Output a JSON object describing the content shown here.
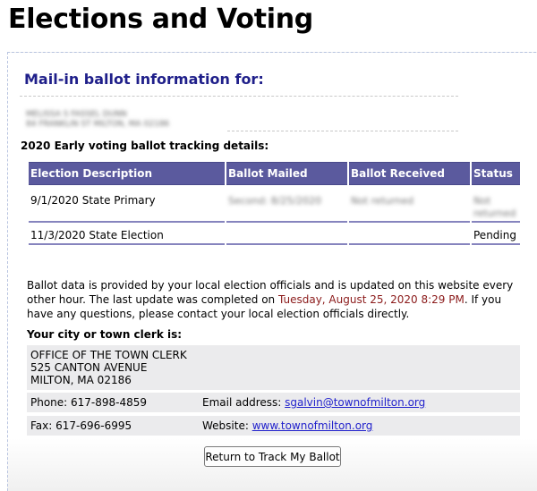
{
  "page": {
    "title": "Elections and Voting"
  },
  "panel": {
    "heading": "Mail-in ballot information for:",
    "voter": {
      "name_line": "MELISSA S FASSEL DUNN",
      "address_line": "84 FRANKLIN ST MILTON, MA 02186",
      "redacted": true
    }
  },
  "tracking": {
    "section_title": "2020  Early voting ballot tracking details:",
    "columns": [
      "Election Description",
      "Ballot Mailed",
      "Ballot Received",
      "Status"
    ],
    "rows": [
      {
        "election": "9/1/2020 State Primary",
        "mailed": "Second: 8/25/2020",
        "received": "Not returned",
        "status": "Not returned",
        "redacted": true
      },
      {
        "election": "11/3/2020 State Election",
        "mailed": "",
        "received": "",
        "status": "Pending"
      }
    ]
  },
  "info": {
    "text_before": "Ballot data is provided by your local election officials and is updated on this website every other hour. The last update was completed on ",
    "last_update": "Tuesday, August 25, 2020 8:29 PM",
    "text_after": ". If you have any questions, please contact your local election officials directly."
  },
  "clerk": {
    "title": "Your city or town clerk is:",
    "office": "OFFICE OF THE TOWN CLERK",
    "street": "525 CANTON AVENUE",
    "city": "MILTON, MA 02186",
    "phone_label": "Phone: ",
    "phone": "617-898-4859",
    "email_label": "Email address: ",
    "email": "sgalvin@townofmilton.org",
    "fax_label": "Fax: ",
    "fax": "617-696-6995",
    "website_label": "Website: ",
    "website": "www.townofmilton.org"
  },
  "actions": {
    "return_label": "Return to Track My Ballot"
  },
  "colors": {
    "heading": "#1f1f8a",
    "table_header": "#5b5a9e",
    "update_time": "#8b1a1a",
    "link": "#2222cc",
    "gray_box": "#ebebed"
  }
}
